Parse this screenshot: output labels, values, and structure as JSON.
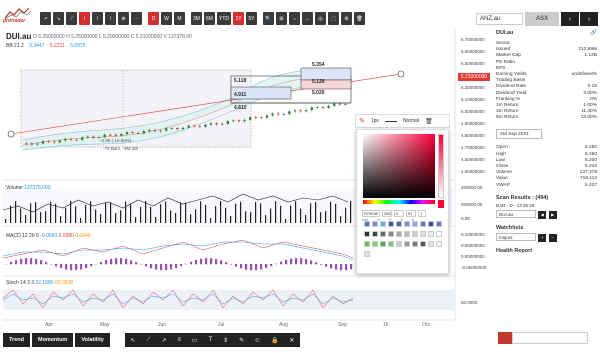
{
  "logo_text": "protrader",
  "toolbar": {
    "tools": [
      "↗",
      "↘",
      "⟋",
      "⌇",
      "⌇",
      "⌇",
      "⊕",
      "⋯"
    ],
    "periods": [
      "D",
      "W",
      "M"
    ],
    "ranges": [
      "3M",
      "6M",
      "YTD",
      "1Y",
      "5Y"
    ],
    "icons": [
      "🔍",
      "⊞",
      "⇔",
      "↔",
      "◎",
      "⬚",
      "⚙",
      "🗑"
    ]
  },
  "search": {
    "value": "ANZ.au"
  },
  "exchange": "ASX",
  "chart": {
    "ticker": "DUI.au",
    "ohlc": "O 5.25000000 H 5.25000000 L 5.20000000 C 5.21000000 V 137378.00",
    "bb_label": "BB 21 2",
    "bb_values": [
      "5.3447",
      "5.2211",
      "5.0975"
    ],
    "price_current": "5.21000000",
    "y_axis": [
      "5.70000000",
      "5.60000000",
      "5.50000000",
      "5.40000000",
      "5.30000000",
      "5.20000000",
      "5.10000000",
      "5.00000000",
      "4.90000000",
      "4.80000000",
      "4.70000000",
      "4.60000000",
      "4.50000000",
      "4.40000000",
      "4.30000000"
    ],
    "annotations": [
      "5.354",
      "5.118",
      "4.911",
      "5.126",
      "5.020",
      "4.810"
    ],
    "notes": [
      "-0.90 (-16.90%)",
      "-76 Bars, -3M 3W"
    ],
    "x_axis": [
      "Apr",
      "May",
      "Jun",
      "Jul",
      "Aug",
      "Sep",
      "16",
      "Oct"
    ],
    "volume": {
      "label": "Volume",
      "value": "137378.000",
      "y_axis": [
        "400000.00",
        "200000.00",
        "0.00"
      ]
    },
    "macd": {
      "label": "MACD 12 26 9",
      "values": [
        "-0.0060",
        "0.0380",
        "0.0440"
      ],
      "y_axis": [
        "0.10000000",
        "0.05000000",
        "0.00000000",
        "-0.05000000"
      ]
    },
    "stoch": {
      "label": "Stoch 14 3 3",
      "values": [
        "52.1680",
        "60.0538"
      ],
      "y_axis": [
        "50.0000"
      ]
    }
  },
  "popup": {
    "width_label": "1px",
    "style_label": "Normal",
    "hex_value": "FF0038",
    "r": "255",
    "g": "0",
    "b": "57",
    "a": "1",
    "labels": [
      "Hex",
      "R",
      "G",
      "B",
      "A"
    ]
  },
  "fundamentals": {
    "title": "DUI.au",
    "rows": [
      {
        "k": "Sector",
        "v": ""
      },
      {
        "k": "Issued",
        "v": "212.89M"
      },
      {
        "k": "Market Cap",
        "v": "1.12B"
      },
      {
        "k": "PE Ratio",
        "v": ""
      },
      {
        "k": "EPS",
        "v": ""
      },
      {
        "k": "Earning Yields",
        "v": "undefined%"
      },
      {
        "k": "Trading Basis",
        "v": ""
      },
      {
        "k": "Dividend Rate",
        "v": "0.15"
      },
      {
        "k": "Dividend Yield",
        "v": "3.00%"
      },
      {
        "k": "Franking %",
        "v": "0%"
      },
      {
        "k": "1m Return",
        "v": "1.00%"
      },
      {
        "k": "3m Return",
        "v": "11.40%"
      },
      {
        "k": "6m Return",
        "v": "13.00%"
      }
    ],
    "date": "3rd Sep 2021",
    "price_rows": [
      {
        "k": "Open",
        "v": "5.250"
      },
      {
        "k": "High",
        "v": "5.250"
      },
      {
        "k": "Low",
        "v": "5.200"
      },
      {
        "k": "Close",
        "v": "5.210"
      },
      {
        "k": "Volume",
        "v": "137,378"
      },
      {
        "k": "Value",
        "v": "718,113"
      },
      {
        "k": "VWAP",
        "v": "5.227"
      }
    ],
    "scan_title": "Scan Results : (494)",
    "scan_row": "DAR - D - 13:35:29",
    "scan_input": "DUI.au",
    "watchlists_title": "Watchlists",
    "watch_input": "majors",
    "health_title": "Health Report"
  },
  "bottom": {
    "trend": "Trend",
    "momentum": "Momentum",
    "volatility": "Volatility"
  }
}
